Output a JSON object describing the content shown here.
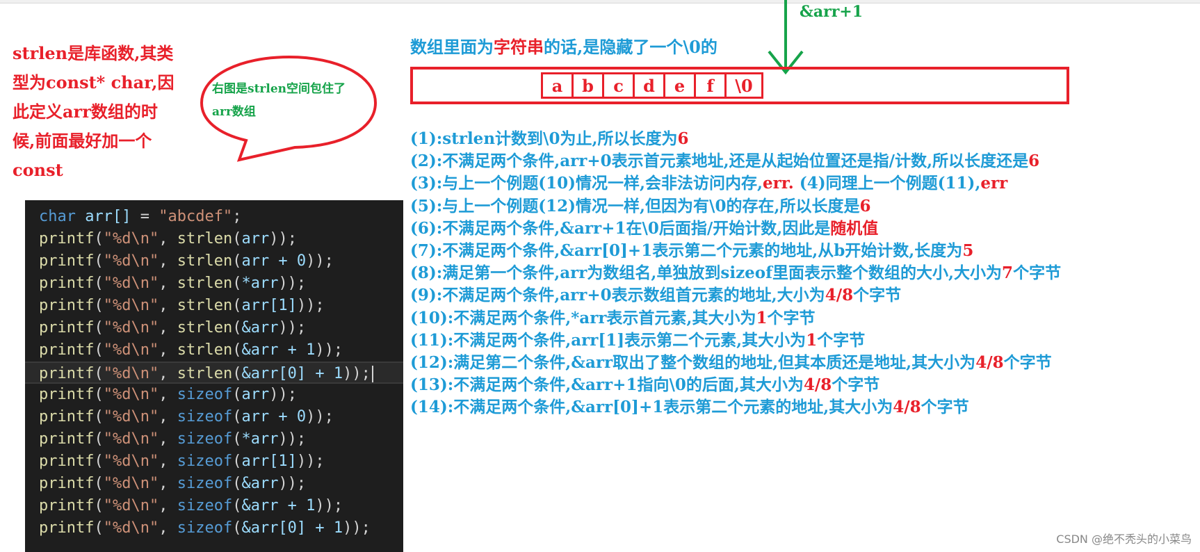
{
  "left_note": {
    "lines": [
      "strlen是库函数,其类",
      "型为const* char,因",
      "此定义arr数组的时",
      "候,前面最好加一个",
      "const"
    ]
  },
  "bubble": {
    "lines": [
      "右图是strlen空间包住了",
      "arr数组"
    ]
  },
  "code": {
    "decl_type": "char",
    "decl_var": "arr[]",
    "decl_eq": " = ",
    "decl_str": "\"abcdef\"",
    "decl_end": ";",
    "lines": [
      {
        "func": "strlen",
        "arg": "arr"
      },
      {
        "func": "strlen",
        "arg": "arr + 0"
      },
      {
        "func": "strlen",
        "arg": "*arr"
      },
      {
        "func": "strlen",
        "arg": "arr[1]"
      },
      {
        "func": "strlen",
        "arg": "&arr"
      },
      {
        "func": "strlen",
        "arg": "&arr + 1"
      },
      {
        "func": "strlen",
        "arg": "&arr[0] + 1"
      },
      {
        "func": "sizeof",
        "arg": "arr"
      },
      {
        "func": "sizeof",
        "arg": "arr + 0"
      },
      {
        "func": "sizeof",
        "arg": "*arr"
      },
      {
        "func": "sizeof",
        "arg": "arr[1]"
      },
      {
        "func": "sizeof",
        "arg": "&arr"
      },
      {
        "func": "sizeof",
        "arg": "&arr + 1"
      },
      {
        "func": "sizeof",
        "arg": "&arr[0] + 1"
      }
    ],
    "printf": "printf",
    "fmt": "\"%d\\n\""
  },
  "diagram": {
    "title_pre": "数组里面为",
    "title_red": "字符串",
    "title_post": "的话,是隐藏了一个\\0的",
    "cells": [
      "a",
      "b",
      "c",
      "d",
      "e",
      "f",
      "\\0"
    ],
    "arrow_label": "&arr+1"
  },
  "explanations": [
    {
      "pre": "(1):strlen计数到\\0为止,所以长度为",
      "red": "6",
      "post": ""
    },
    {
      "pre": "(2):不满足两个条件,arr+0表示首元素地址,还是从起始位置还是指/计数,所以长度还是",
      "red": "6",
      "post": ""
    },
    {
      "pre": "(3):与上一个例题(10)情况一样,会非法访问内存,",
      "red": "err.",
      "post": " (4)同理上一个例题(11),",
      "red2": "err"
    },
    {
      "pre": "(5):与上一个例题(12)情况一样,但因为有\\0的存在,所以长度是",
      "red": "6",
      "post": ""
    },
    {
      "pre": "(6):不满足两个条件,&arr+1在\\0后面指/开始计数,因此是",
      "red": "随机值",
      "post": ""
    },
    {
      "pre": "(7):不满足两个条件,&arr[0]+1表示第二个元素的地址,从b开始计数,长度为",
      "red": "5",
      "post": ""
    },
    {
      "pre": "(8):满足第一个条件,arr为数组名,单独放到sizeof里面表示整个数组的大小,大小为",
      "red": "7",
      "post": "个字节"
    },
    {
      "pre": "(9):不满足两个条件,arr+0表示数组首元素的地址,大小为",
      "red": "4/8",
      "post": "个字节"
    },
    {
      "pre": "(10):不满足两个条件,*arr表示首元素,其大小为",
      "red": "1",
      "post": "个字节"
    },
    {
      "pre": "(11):不满足两个条件,arr[1]表示第二个元素,其大小为",
      "red": "1",
      "post": "个字节"
    },
    {
      "pre": "(12):满足第二个条件,&arr取出了整个数组的地址,但其本质还是地址,其大小为",
      "red": "4/8",
      "post": "个字节"
    },
    {
      "pre": "(13):不满足两个条件,&arr+1指向\\0的后面,其大小为",
      "red": "4/8",
      "post": "个字节"
    },
    {
      "pre": "(14):不满足两个条件,&arr[0]+1表示第二个元素的地址,其大小为",
      "red": "4/8",
      "post": "个字节"
    }
  ],
  "footer": "CSDN @绝不秃头的小菜鸟",
  "colors": {
    "red": "#e8202a",
    "blue": "#1e9bd6",
    "green": "#16a34a",
    "code_bg": "#1e1e1e"
  }
}
